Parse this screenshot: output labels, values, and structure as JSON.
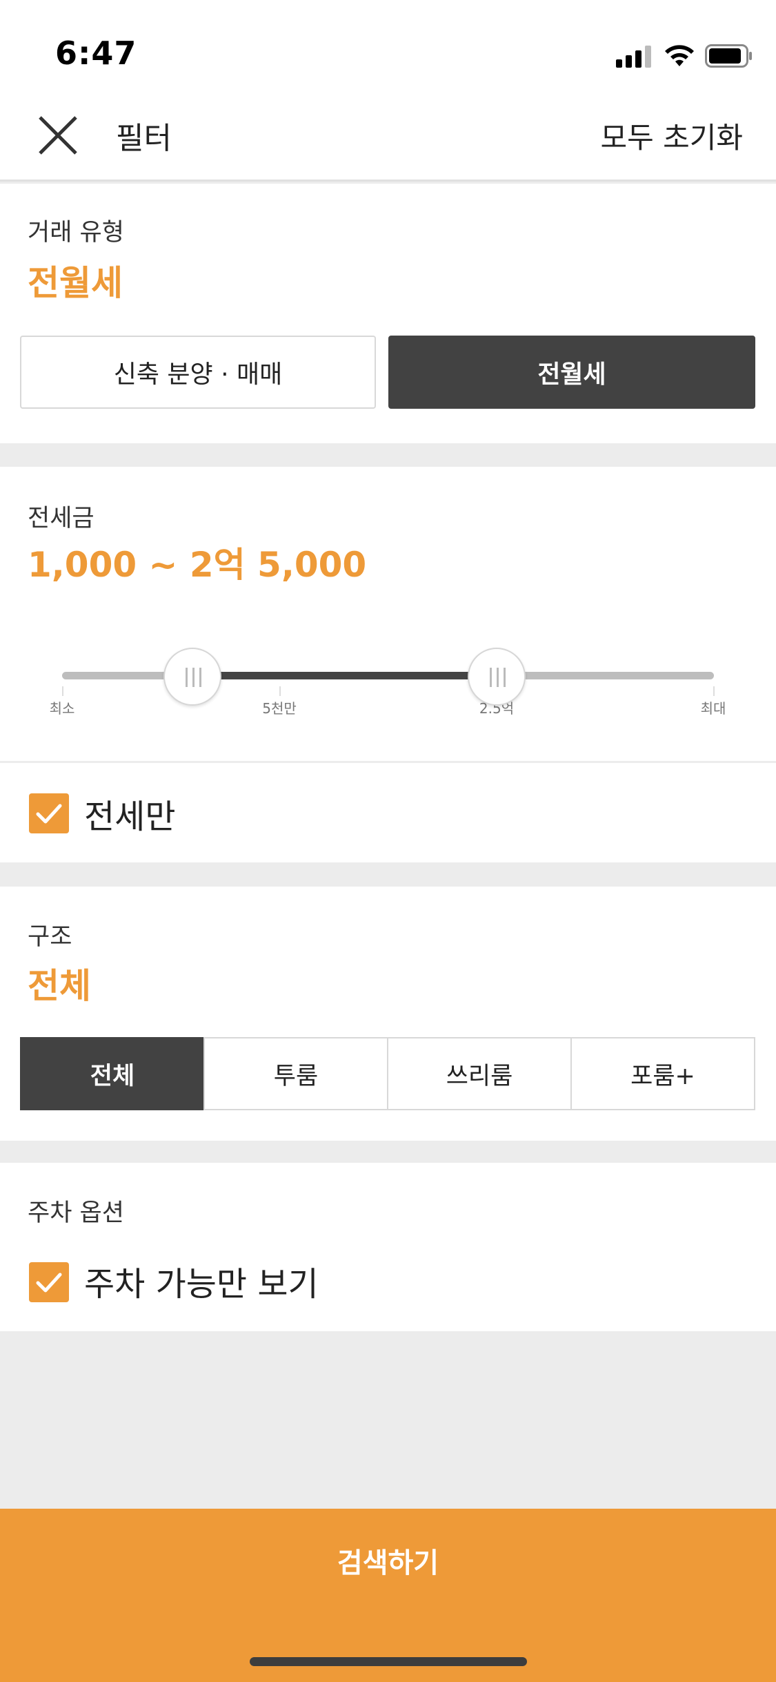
{
  "status": {
    "time": "6:47"
  },
  "header": {
    "title": "필터",
    "reset_label": "모두 초기화"
  },
  "deal_type": {
    "label": "거래 유형",
    "selected": "전월세",
    "options": [
      "신축 분양 · 매매",
      "전월세"
    ]
  },
  "deposit": {
    "label": "전세금",
    "value_text": "1,000 ~ 2억 5,000",
    "ticks": [
      "최소",
      "5천만",
      "2.5억",
      "최대"
    ],
    "range_fraction": [
      0.2,
      0.667
    ]
  },
  "jeonse_only": {
    "label": "전세만",
    "checked": true
  },
  "structure": {
    "label": "구조",
    "selected": "전체",
    "options": [
      "전체",
      "투룸",
      "쓰리룸",
      "포룸+"
    ]
  },
  "parking": {
    "label": "주차 옵션",
    "option_label": "주차 가능만 보기",
    "checked": true
  },
  "search": {
    "button_label": "검색하기"
  },
  "colors": {
    "accent": "#ee9a38",
    "dark": "#424242",
    "divider": "#ececec"
  }
}
